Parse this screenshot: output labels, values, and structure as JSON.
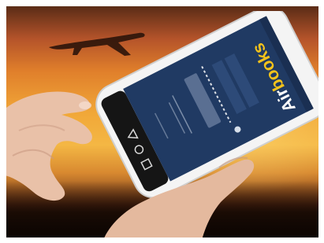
{
  "scene": {
    "description_items": [
      "sunset-sky",
      "airplane-silhouette",
      "hands",
      "smartphone"
    ],
    "colors": {
      "sky_top": "#5a2c16",
      "sky_mid": "#f1a738",
      "phone_body": "#f4f4f4",
      "screen_bg": "#203a63",
      "accent_yellow": "#f3c21b"
    }
  },
  "app": {
    "logo_prefix": "Air",
    "logo_suffix": "books"
  }
}
